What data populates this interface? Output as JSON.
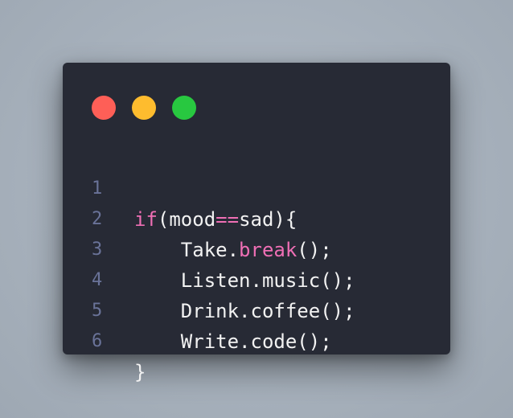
{
  "window": {
    "controls": [
      {
        "name": "close",
        "color": "#fe5f57"
      },
      {
        "name": "minimize",
        "color": "#febc2e"
      },
      {
        "name": "maximize",
        "color": "#28c840"
      }
    ]
  },
  "code": {
    "keyword_color": "#ef6fb5",
    "text_color": "#f2f2f2",
    "line_number_color": "#6a7399",
    "lines": [
      {
        "number": "1",
        "indent": "",
        "tokens": [
          {
            "text": "if",
            "keyword": true
          },
          {
            "text": "(mood",
            "keyword": false
          },
          {
            "text": "==",
            "keyword": true
          },
          {
            "text": "sad){",
            "keyword": false
          }
        ]
      },
      {
        "number": "2",
        "indent": "    ",
        "tokens": [
          {
            "text": "Take.",
            "keyword": false
          },
          {
            "text": "break",
            "keyword": true
          },
          {
            "text": "();",
            "keyword": false
          }
        ]
      },
      {
        "number": "3",
        "indent": "    ",
        "tokens": [
          {
            "text": "Listen.music();",
            "keyword": false
          }
        ]
      },
      {
        "number": "4",
        "indent": "    ",
        "tokens": [
          {
            "text": "Drink.coffee();",
            "keyword": false
          }
        ]
      },
      {
        "number": "5",
        "indent": "    ",
        "tokens": [
          {
            "text": "Write.code();",
            "keyword": false
          }
        ]
      },
      {
        "number": "6",
        "indent": "",
        "tokens": [
          {
            "text": "}",
            "keyword": false
          }
        ]
      }
    ]
  }
}
